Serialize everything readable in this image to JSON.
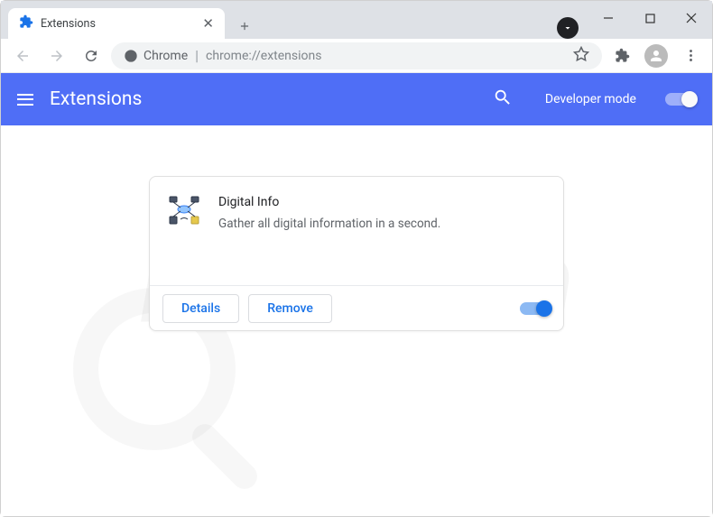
{
  "tab": {
    "title": "Extensions"
  },
  "addressbar": {
    "chip": "Chrome",
    "url": "chrome://extensions"
  },
  "extensions_page": {
    "title": "Extensions",
    "dev_mode_label": "Developer mode"
  },
  "extension_card": {
    "name": "Digital Info",
    "description": "Gather all digital information in a second.",
    "details_label": "Details",
    "remove_label": "Remove",
    "enabled": true
  },
  "watermark": {
    "text": "risk.com"
  }
}
